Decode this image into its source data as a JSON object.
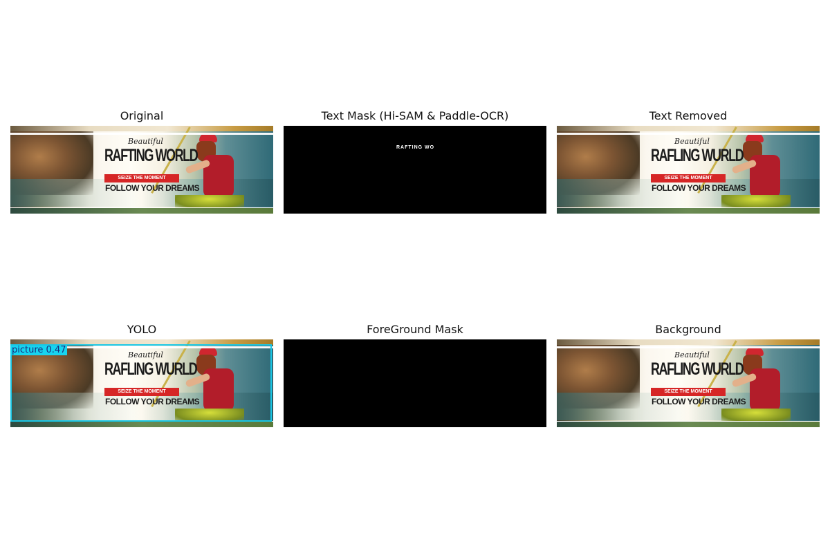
{
  "panels": [
    {
      "id": "original",
      "title": "Original"
    },
    {
      "id": "text_mask",
      "title": "Text Mask (Hi-SAM & Paddle-OCR)"
    },
    {
      "id": "text_removed",
      "title": "Text Removed"
    },
    {
      "id": "yolo",
      "title": "YOLO"
    },
    {
      "id": "foreground_mask",
      "title": "ForeGround Mask"
    },
    {
      "id": "background",
      "title": "Background"
    }
  ],
  "banner_text": {
    "beautiful": "Beautiful",
    "beautiful_partial": "Beautiful",
    "title": "RAFTING WORLD",
    "title_altered": "RAFLING WURLD",
    "tagline": "SEIZE THE MOMENT",
    "follow": "FOLLOW YOUR DREAMS"
  },
  "mask_text": "RAFTING WO",
  "yolo_detection": {
    "label": "picture 0.47",
    "color": "#19c7e6"
  },
  "colors": {
    "mask_background": "#000000",
    "banner_red": "#d62626"
  }
}
